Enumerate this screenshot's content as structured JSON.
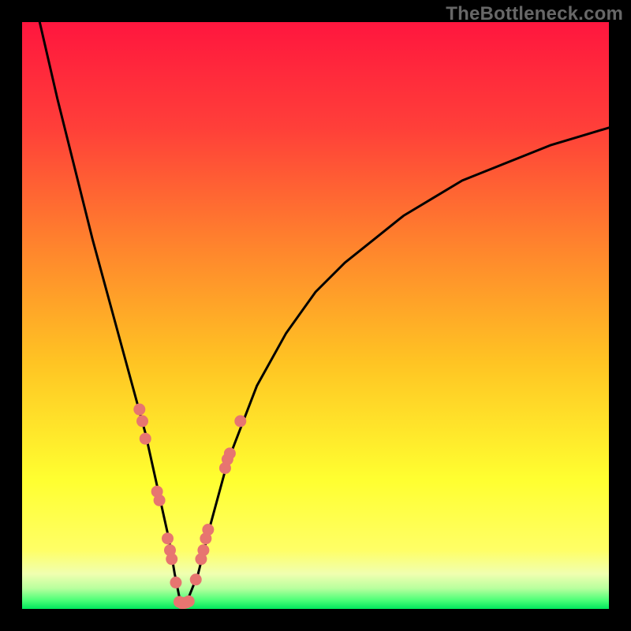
{
  "watermark": "TheBottleneck.com",
  "colors": {
    "frame": "#000000",
    "gradient_top": "#ff163e",
    "gradient_mid1": "#ff6a2e",
    "gradient_mid2": "#ffd421",
    "gradient_low": "#ffff33",
    "gradient_pale": "#f6ffb0",
    "gradient_green": "#00e85c",
    "curve": "#000000",
    "dot": "#e77570",
    "watermark": "#676767"
  },
  "chart_data": {
    "type": "line",
    "title": "",
    "xlabel": "",
    "ylabel": "",
    "xlim": [
      0,
      100
    ],
    "ylim": [
      0,
      100
    ],
    "grid": false,
    "legend": false,
    "annotations": [
      "TheBottleneck.com"
    ],
    "series": [
      {
        "name": "bottleneck-curve",
        "x": [
          3,
          6,
          9,
          12,
          15,
          18,
          21,
          23,
          25,
          26,
          27,
          28,
          30,
          32,
          35,
          40,
          45,
          50,
          55,
          60,
          65,
          70,
          75,
          80,
          85,
          90,
          95,
          100
        ],
        "y": [
          100,
          87,
          75,
          63,
          52,
          41,
          30,
          21,
          12,
          6,
          1,
          1,
          6,
          14,
          25,
          38,
          47,
          54,
          59,
          63,
          67,
          70,
          73,
          75,
          77,
          79,
          80.5,
          82
        ]
      }
    ],
    "markers": [
      {
        "name": "dots-left-branch",
        "x": [
          20.0,
          20.5,
          21.0,
          23.0,
          23.4,
          24.8,
          25.2,
          25.5,
          26.2
        ],
        "y": [
          34.0,
          32.0,
          29.0,
          20.0,
          18.5,
          12.0,
          10.0,
          8.5,
          4.5
        ]
      },
      {
        "name": "dots-valley",
        "x": [
          26.8,
          27.2,
          27.6,
          28.0,
          28.4
        ],
        "y": [
          1.2,
          1.0,
          1.0,
          1.1,
          1.3
        ]
      },
      {
        "name": "dots-right-branch",
        "x": [
          29.6,
          30.5,
          30.9,
          31.3,
          31.7,
          34.6,
          35.0,
          35.4,
          37.2
        ],
        "y": [
          5.0,
          8.5,
          10.0,
          12.0,
          13.5,
          24.0,
          25.5,
          26.5,
          32.0
        ]
      }
    ]
  }
}
